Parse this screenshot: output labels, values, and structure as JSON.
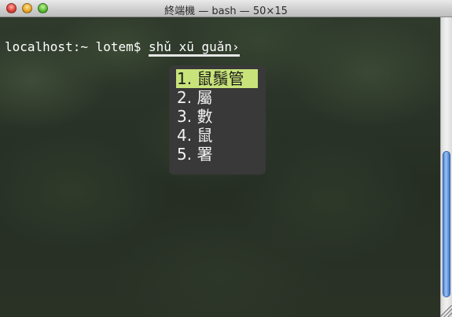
{
  "window": {
    "title": "終端機 — bash — 50×15"
  },
  "terminal": {
    "prompt": "localhost:~ lotem$ ",
    "composing_text": "shǔ xū guǎn›"
  },
  "candidate_list": {
    "selected_index": 0,
    "items": [
      "1. 鼠鬚管",
      "2. 屬",
      "3. 數",
      "4. 鼠",
      "5. 署"
    ]
  },
  "colors": {
    "selected_candidate": "#c8e37a",
    "candidate_panel": "#3a3a3a",
    "scroll_thumb": "#4f86d6"
  },
  "icons": {
    "close": "close-button-red",
    "minimize": "minimize-button-yellow",
    "zoom": "zoom-button-green"
  }
}
